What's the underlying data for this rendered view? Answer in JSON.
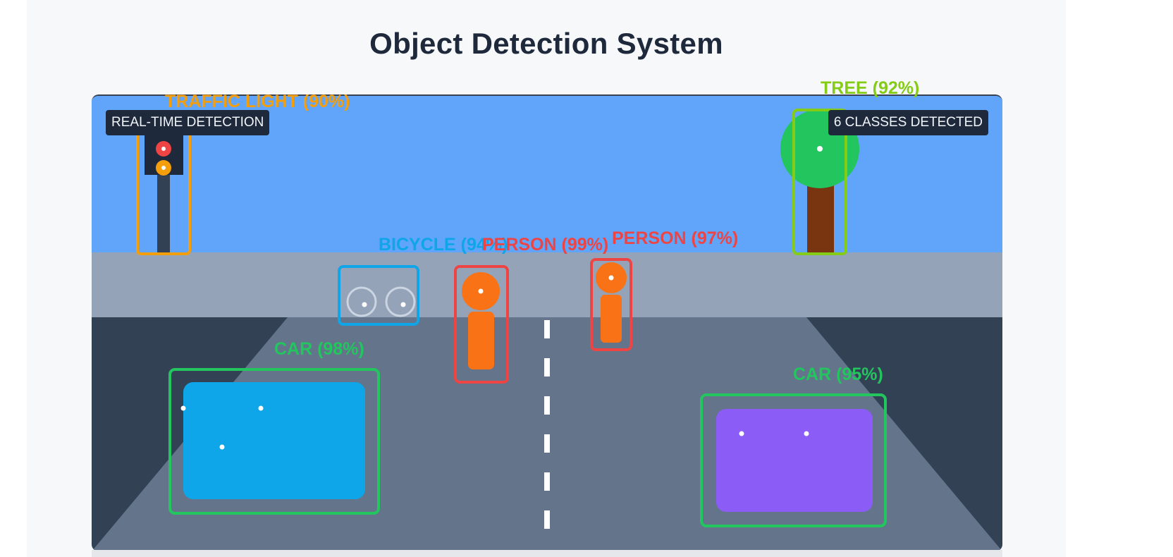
{
  "page": {
    "title": "Object Detection System"
  },
  "overlay": {
    "left_badge": "REAL-TIME DETECTION",
    "right_badge": "6 CLASSES DETECTED"
  },
  "detections": [
    {
      "label": "TRAFFIC LIGHT (90%)",
      "class": "traffic light",
      "confidence": 0.9,
      "color": "#f59e0b"
    },
    {
      "label": "TREE (92%)",
      "class": "tree",
      "confidence": 0.92,
      "color": "#84cc16"
    },
    {
      "label": "BICYCLE (94%)",
      "class": "bicycle",
      "confidence": 0.94,
      "color": "#0ea5e9"
    },
    {
      "label": "PERSON (99%)",
      "class": "person",
      "confidence": 0.99,
      "color": "#ef4444"
    },
    {
      "label": "PERSON (97%)",
      "class": "person",
      "confidence": 0.97,
      "color": "#ef4444"
    },
    {
      "label": "CAR (98%)",
      "class": "car",
      "confidence": 0.98,
      "color": "#22c55e"
    },
    {
      "label": "CAR (95%)",
      "class": "car",
      "confidence": 0.95,
      "color": "#22c55e"
    }
  ],
  "colors": {
    "sky": "#60a5fa",
    "sidewalk": "#94a3b8",
    "road": "#64748b",
    "roadside": "#334155",
    "car_left": "#0ea5e9",
    "car_right": "#8b5cf6",
    "person": "#f97316",
    "tree_canopy": "#22c55e",
    "tree_trunk": "#78350f"
  }
}
